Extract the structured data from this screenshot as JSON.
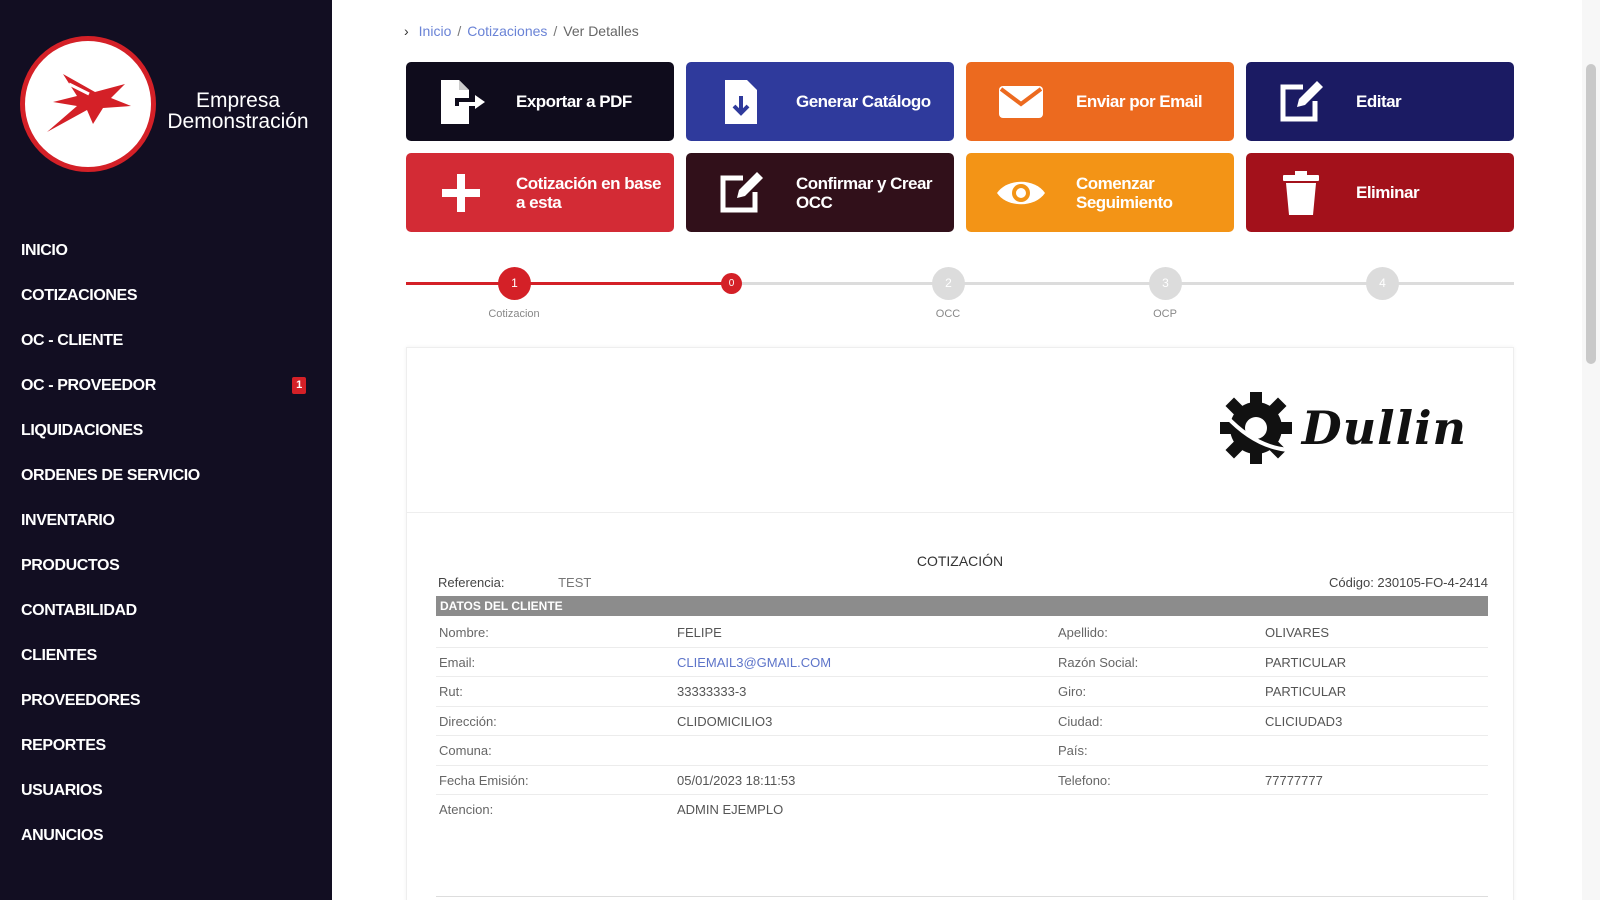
{
  "brand": {
    "name_line1": "Empresa",
    "name_line2": "Demonstración"
  },
  "sidebar": {
    "items": [
      {
        "label": "INICIO"
      },
      {
        "label": "COTIZACIONES"
      },
      {
        "label": "OC - CLIENTE"
      },
      {
        "label": "OC - PROVEEDOR",
        "badge": "1"
      },
      {
        "label": "LIQUIDACIONES"
      },
      {
        "label": "ORDENES DE SERVICIO"
      },
      {
        "label": "INVENTARIO"
      },
      {
        "label": "PRODUCTOS"
      },
      {
        "label": "CONTABILIDAD"
      },
      {
        "label": "CLIENTES"
      },
      {
        "label": "PROVEEDORES"
      },
      {
        "label": "REPORTES"
      },
      {
        "label": "USUARIOS"
      },
      {
        "label": "ANUNCIOS"
      }
    ]
  },
  "breadcrumb": {
    "home": "Inicio",
    "section": "Cotizaciones",
    "current": "Ver Detalles",
    "separator": "/"
  },
  "actions": [
    {
      "label": "Exportar a PDF",
      "color": "#0f0c1c",
      "icon": "file-export-icon"
    },
    {
      "label": "Generar Catálogo",
      "color": "#2f3a9c",
      "icon": "file-download-icon"
    },
    {
      "label": "Enviar por Email",
      "color": "#ec6a1f",
      "icon": "envelope-icon"
    },
    {
      "label": "Editar",
      "color": "#1b1b63",
      "icon": "edit-icon"
    },
    {
      "label": "Cotización en base a esta",
      "color": "#d32b35",
      "icon": "plus-icon"
    },
    {
      "label": "Confirmar y Crear OCC",
      "color": "#31101a",
      "icon": "edit-icon"
    },
    {
      "label": "Comenzar Seguimiento",
      "color": "#f39416",
      "icon": "eye-icon"
    },
    {
      "label": "Eliminar",
      "color": "#a3111b",
      "icon": "trash-icon"
    }
  ],
  "stepper": {
    "steps": [
      {
        "number": "1",
        "label": "Cotizacion",
        "active": true
      },
      {
        "number": "0",
        "label": "",
        "active": true
      },
      {
        "number": "2",
        "label": "OCC",
        "active": false
      },
      {
        "number": "3",
        "label": "OCP",
        "active": false
      },
      {
        "number": "4",
        "label": "",
        "active": false
      }
    ],
    "active_color": "#d42027",
    "inactive_color": "#dcdcdc"
  },
  "document": {
    "logo_text": "Dullin",
    "title": "COTIZACIÓN",
    "reference_label": "Referencia:",
    "reference_value": "TEST",
    "code": "Código: 230105-FO-4-2414",
    "section_title": "DATOS DEL CLIENTE",
    "client_rows": [
      {
        "l1": "Nombre:",
        "v1": "FELIPE",
        "l2": "Apellido:",
        "v2": "OLIVARES"
      },
      {
        "l1": "Email:",
        "v1": "CLIEMAIL3@GMAIL.COM",
        "l2": "Razón Social:",
        "v2": "PARTICULAR"
      },
      {
        "l1": "Rut:",
        "v1": "33333333-3",
        "l2": "Giro:",
        "v2": "PARTICULAR"
      },
      {
        "l1": "Dirección:",
        "v1": "CLIDOMICILIO3",
        "l2": "Ciudad:",
        "v2": "CLICIUDAD3"
      },
      {
        "l1": "Comuna:",
        "v1": "",
        "l2": "País:",
        "v2": ""
      },
      {
        "l1": "Fecha Emisión:",
        "v1": "05/01/2023 18:11:53",
        "l2": "Telefono:",
        "v2": "77777777"
      },
      {
        "l1": "Atencion:",
        "v1": "ADMIN EJEMPLO",
        "l2": "",
        "v2": ""
      }
    ]
  }
}
